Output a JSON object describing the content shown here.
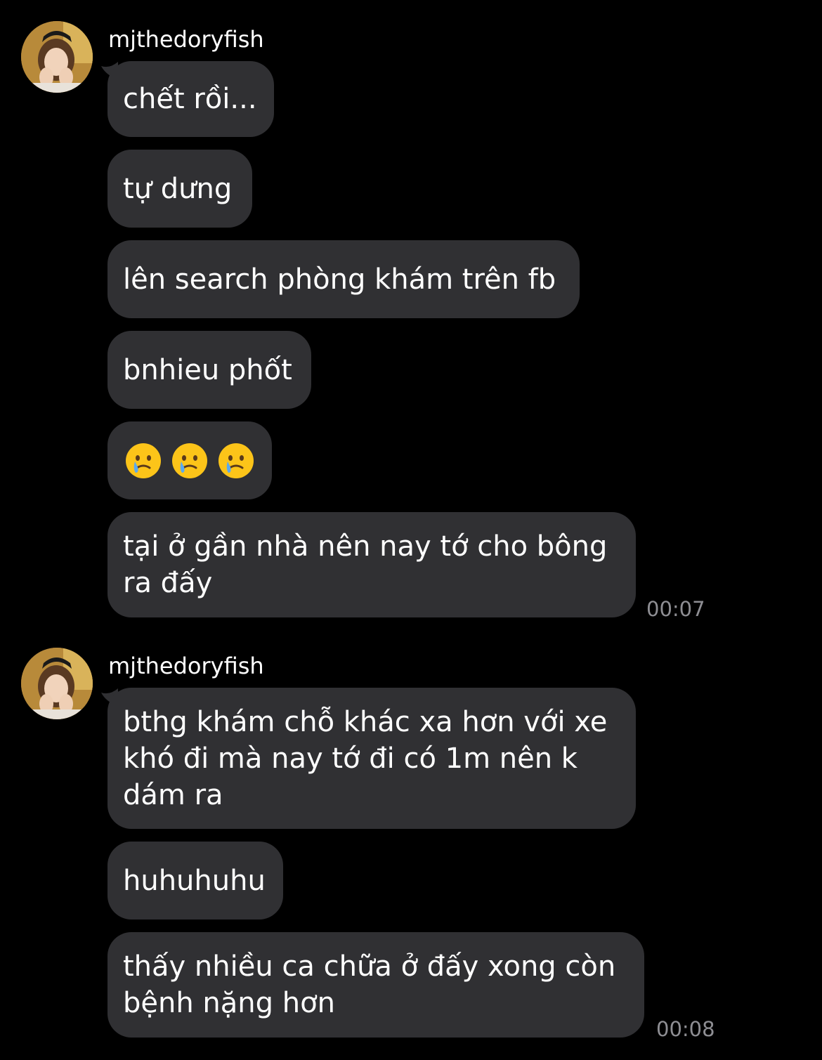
{
  "groups": [
    {
      "sender": "mjthedoryfish",
      "messages": [
        {
          "text": "chết rồi..."
        },
        {
          "text": "tự dưng"
        },
        {
          "text": "lên search phòng khám trên fb"
        },
        {
          "text": "bnhieu phốt"
        },
        {
          "emoji": [
            "crying-smile-emoji",
            "crying-smile-emoji",
            "crying-smile-emoji"
          ]
        },
        {
          "text": "tại ở gần nhà nên nay tớ cho bông ra đấy"
        }
      ],
      "time": "00:07"
    },
    {
      "sender": "mjthedoryfish",
      "messages": [
        {
          "text": "bthg khám chỗ khác xa hơn với xe khó đi mà nay tớ đi có 1m nên k dám ra"
        },
        {
          "text": "huhuhuhu"
        },
        {
          "text": "thấy nhiều ca chữa ở đấy xong còn bệnh nặng hơn"
        }
      ],
      "time": "00:08"
    }
  ],
  "colors": {
    "background": "#000000",
    "bubble": "#303033",
    "text": "#ffffff",
    "timestamp": "#8e8e93"
  }
}
